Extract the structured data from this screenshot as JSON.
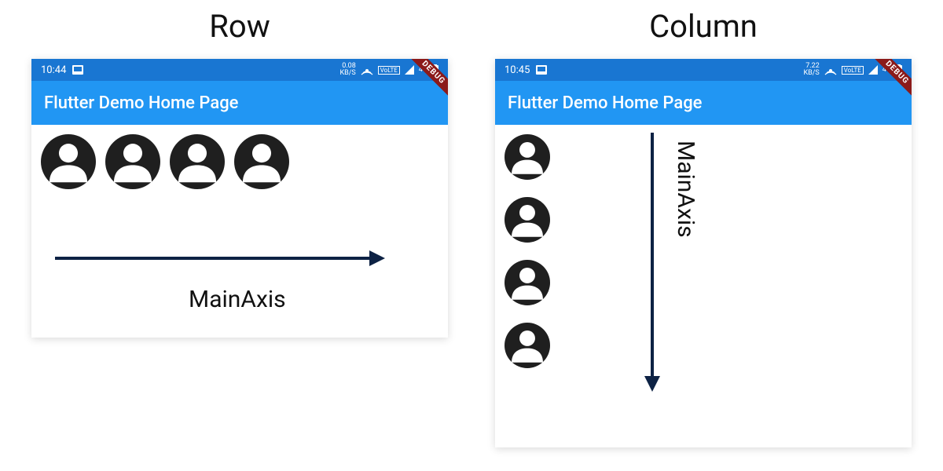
{
  "diagram": {
    "row": {
      "heading": "Row",
      "axis_label": "MainAxis",
      "arrow_dir": "right"
    },
    "column": {
      "heading": "Column",
      "axis_label": "MainAxis",
      "arrow_dir": "down"
    }
  },
  "phones": {
    "row": {
      "status": {
        "time": "10:44",
        "kbs_top": "0.08",
        "kbs_bottom": "KB/S",
        "volte": "VoLTE",
        "net": "4G"
      },
      "appbar_title": "Flutter Demo Home Page",
      "debug_banner": "DEBUG",
      "icons_count": 4
    },
    "column": {
      "status": {
        "time": "10:45",
        "kbs_top": "7.22",
        "kbs_bottom": "KB/S",
        "volte": "VoLTE",
        "net": "4G"
      },
      "appbar_title": "Flutter Demo Home Page",
      "debug_banner": "DEBUG",
      "icons_count": 4
    }
  },
  "colors": {
    "status_bg": "#1976D2",
    "appbar_bg": "#2196F3",
    "icon_fg": "#1f1f1f",
    "arrow": "#0d2244",
    "debug_bg": "#8B1A1A"
  }
}
